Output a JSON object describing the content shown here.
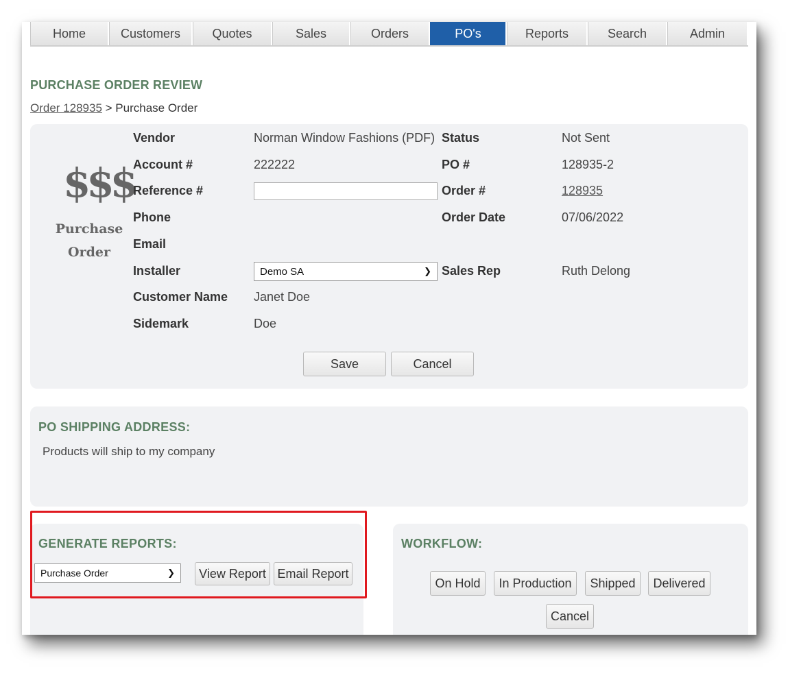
{
  "nav": {
    "items": [
      {
        "label": "Home"
      },
      {
        "label": "Customers"
      },
      {
        "label": "Quotes"
      },
      {
        "label": "Sales"
      },
      {
        "label": "Orders"
      },
      {
        "label": "PO's"
      },
      {
        "label": "Reports"
      },
      {
        "label": "Search"
      },
      {
        "label": "Admin"
      }
    ],
    "active": "PO's",
    "active_color": "#1f5fa8"
  },
  "page_title": "PURCHASE ORDER REVIEW",
  "breadcrumb": {
    "link": "Order 128935",
    "separator": " > ",
    "current": "Purchase Order"
  },
  "po_icon": {
    "symbol": "$$$",
    "line1": "Purchase",
    "line2": "Order"
  },
  "details": {
    "vendor_label": "Vendor",
    "vendor": "Norman Window Fashions (PDF)",
    "account_label": "Account #",
    "account": "222222",
    "reference_label": "Reference #",
    "reference": "",
    "phone_label": "Phone",
    "email_label": "Email",
    "installer_label": "Installer",
    "installer": "Demo SA",
    "customer_label": "Customer Name",
    "customer": "Janet Doe",
    "sidemark_label": "Sidemark",
    "sidemark": "Doe",
    "status_label": "Status",
    "status": "Not Sent",
    "po_label": "PO #",
    "po": "128935-2",
    "order_label": "Order #",
    "order": "128935",
    "order_date_label": "Order Date",
    "order_date": "07/06/2022",
    "sales_rep_label": "Sales Rep",
    "sales_rep": "Ruth Delong",
    "save": "Save",
    "cancel": "Cancel"
  },
  "shipping": {
    "title": "PO SHIPPING ADDRESS:",
    "text": "Products will ship to my company"
  },
  "reports": {
    "title": "GENERATE REPORTS:",
    "selected": "Purchase Order",
    "view": "View Report",
    "email": "Email Report"
  },
  "workflow": {
    "title": "WORKFLOW:",
    "buttons": [
      "On Hold",
      "In Production",
      "Shipped",
      "Delivered"
    ],
    "cancel": "Cancel"
  },
  "colors": {
    "heading_green": "#5b8063",
    "panel_bg": "#f1f2f4",
    "highlight_red": "#e0191f"
  }
}
